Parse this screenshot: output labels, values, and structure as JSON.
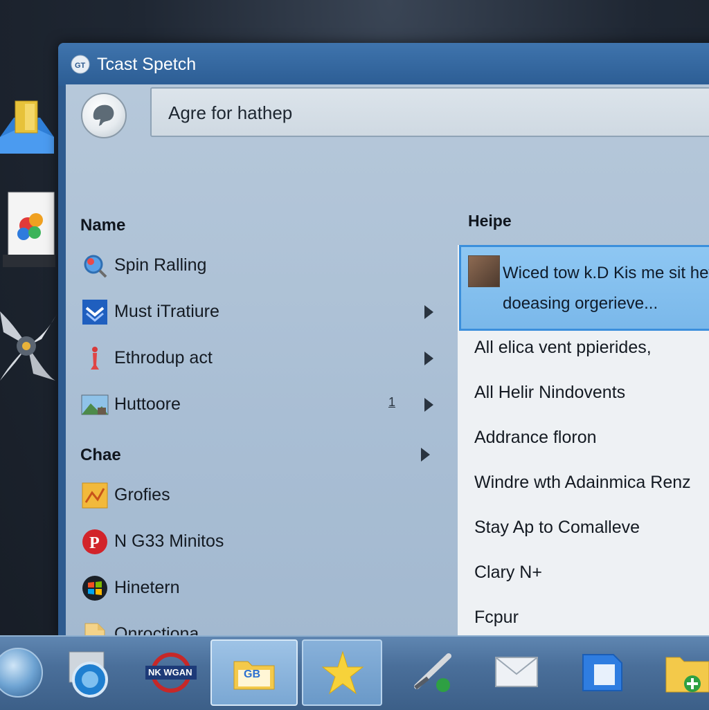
{
  "window": {
    "title": "Tcast Spetch"
  },
  "search": {
    "value": "Agre for hathep"
  },
  "left_pane": {
    "section1_heading": "Name",
    "section1_items": [
      {
        "label": "Spin Ralling",
        "icon": "magnifier-globe-icon"
      },
      {
        "label": "Must iTratiure",
        "icon": "blue-chevron-icon"
      },
      {
        "label": "Ethrodup act",
        "icon": "red-figure-icon"
      },
      {
        "label": "Huttoore",
        "icon": "photo-landscape-icon",
        "badge": "1"
      }
    ],
    "section2_heading": "Chae",
    "section2_items": [
      {
        "label": "Grofies",
        "icon": "yellow-chart-icon"
      },
      {
        "label": "N G33 Minitos",
        "icon": "pinterest-icon"
      },
      {
        "label": "Hinetern",
        "icon": "windows-logo-icon"
      },
      {
        "label": "Onroctiona",
        "icon": "document-folder-icon"
      }
    ]
  },
  "right_pane": {
    "heading": "Heipe",
    "highlight": {
      "line1": "Wiced tow k.D Kis me sit hev",
      "line2": "doeasing orgerieve..."
    },
    "items": [
      "All elica vent ppierides,",
      "All Helir Nindovents",
      "Addrance floron",
      "Windre wth Adainmica Renz",
      "Stay Ap to Comalleve",
      "Clary N+",
      "Fcpur"
    ]
  },
  "taskbar": {
    "network_label": "NK WGAN",
    "folder_badge": "GB",
    "icons": [
      "start-orb-icon",
      "network-globe-icon",
      "network-badge-icon",
      "folder-app-icon",
      "star-icon",
      "tools-icon",
      "mail-icon",
      "shield-icon",
      "folder-add-icon"
    ]
  },
  "colors": {
    "titlebar": "#2e5b8f",
    "content_bg": "#aabfd4",
    "highlight": "#7ab8ea",
    "taskbar": "#4a6f9a"
  }
}
